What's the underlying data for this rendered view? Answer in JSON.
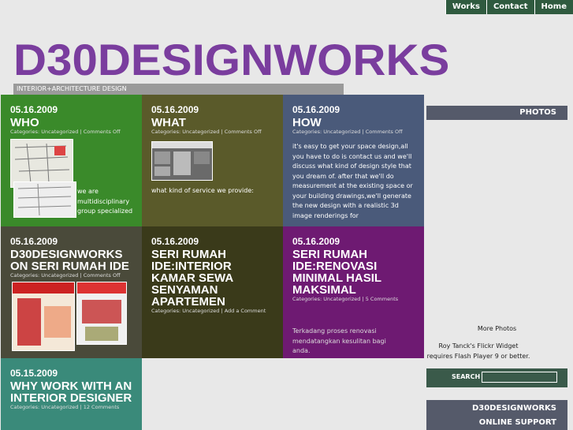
{
  "nav": {
    "works": "Works",
    "contact": "Contact",
    "home": "Home"
  },
  "logo": "D30DESIGNWORKS",
  "tagline": "INTERIOR+ARCHITECTURE DESIGN",
  "tiles": [
    {
      "date": "05.16.2009",
      "title": "WHO",
      "meta": "Categories: Uncategorized | Comments Off",
      "body": "we are multidisciplinary group specialized",
      "color": "#3a8a2a"
    },
    {
      "date": "05.16.2009",
      "title": "WHAT",
      "meta": "Categories: Uncategorized | Comments Off",
      "body": "what kind of service we provide:",
      "color": "#5a5a2a"
    },
    {
      "date": "05.16.2009",
      "title": "HOW",
      "meta": "Categories: Uncategorized | Comments Off",
      "body": "it's easy to get your space design,all you have to do is contact us and we'll discuss what kind of design style that you dream of. after that we'll do measurement at the existing space or your building drawings,we'll generate the new design with a realistic 3d image renderings for",
      "color": "#4a5a7a"
    },
    {
      "date": "05.16.2009",
      "title": "D30DESIGNWORKS ON SERI RUMAH IDE",
      "meta": "Categories: Uncategorized | Comments Off",
      "body": "",
      "color": "#4a4a3a"
    },
    {
      "date": "05.16.2009",
      "title": "SERI RUMAH IDE:INTERIOR KAMAR SEWA SENYAMAN APARTEMEN",
      "meta": "Categories: Uncategorized | Add a Comment",
      "body": "",
      "color": "#3a3a1a"
    },
    {
      "date": "05.16.2009",
      "title": "SERI RUMAH IDE:RENOVASI MINIMAL HASIL MAKSIMAL",
      "meta": "Categories: Uncategorized | 5 Comments",
      "body": "Terkadang proses renovasi mendatangkan kesulitan bagi anda.",
      "color": "#6e1a72"
    },
    {
      "date": "05.15.2009",
      "title": "WHY WORK WITH AN INTERIOR DESIGNER",
      "meta": "Categories: Uncategorized | 12 Comments",
      "body": "",
      "color": "#3a8a7a"
    }
  ],
  "sidebar": {
    "photos": "PHOTOS",
    "more_photos": "More Photos",
    "flickr_note": "Roy Tanck's Flickr Widget requires Flash Player 9 or better.",
    "search_label": "SEARCH",
    "search_value": "",
    "support": "D30DESIGNWORKS ONLINE SUPPORT"
  }
}
